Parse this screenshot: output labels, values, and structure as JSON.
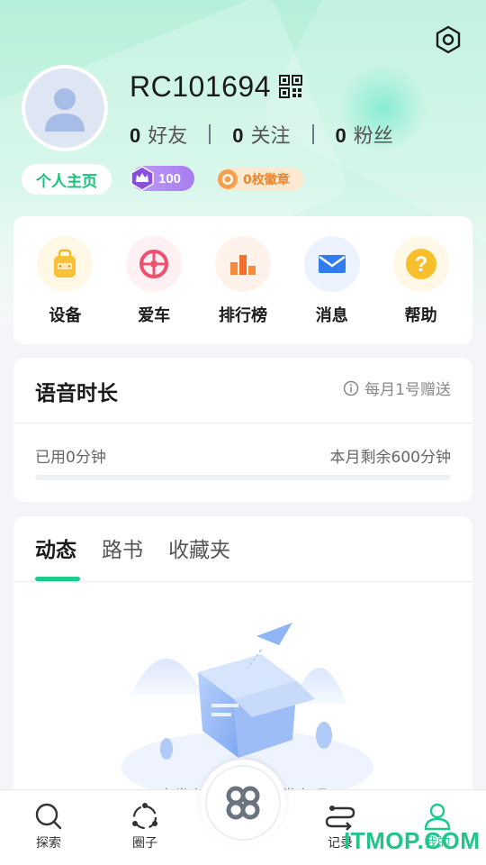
{
  "profile": {
    "username": "RC101694",
    "stats": [
      {
        "num": "0",
        "label": "好友"
      },
      {
        "num": "0",
        "label": "关注"
      },
      {
        "num": "0",
        "label": "粉丝"
      }
    ],
    "home_label": "个人主页",
    "level_value": "100",
    "badge_label": "0枚徽章"
  },
  "menu": [
    {
      "label": "设备",
      "icon": "device-icon"
    },
    {
      "label": "爱车",
      "icon": "wheel-icon"
    },
    {
      "label": "排行榜",
      "icon": "rank-icon"
    },
    {
      "label": "消息",
      "icon": "mail-icon"
    },
    {
      "label": "帮助",
      "icon": "help-icon"
    }
  ],
  "voice": {
    "title": "语音时长",
    "note": "每月1号赠送",
    "used": "已用0分钟",
    "remaining": "本月剩余600分钟",
    "used_fraction": 0
  },
  "feed": {
    "tabs": [
      "动态",
      "路书",
      "收藏夹"
    ],
    "active_tab": 0,
    "empty_text": "未发布动态，快去发布吧"
  },
  "tabbar": {
    "items": [
      {
        "label": "探索",
        "icon": "search-icon"
      },
      {
        "label": "圈子",
        "icon": "circle-icon"
      },
      {
        "label": "记录",
        "icon": "route-icon"
      },
      {
        "label": "我的",
        "icon": "user-icon"
      }
    ],
    "active_index": 3
  },
  "watermark": "ITMOP.COM",
  "colors": {
    "accent": "#1ccb8b",
    "header_top": "#b6f0d9",
    "level": "#a57df0",
    "badge_text": "#e8862f"
  }
}
